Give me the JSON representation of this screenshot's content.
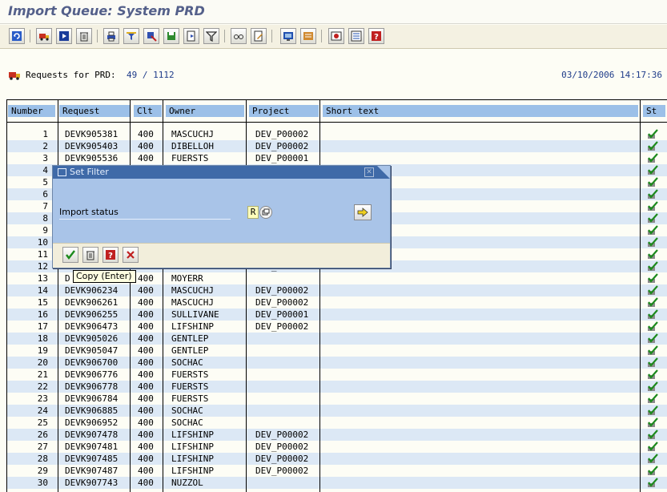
{
  "title": "Import Queue: System PRD",
  "toolbar": {
    "buttons": [
      "refresh-icon",
      "truck-icon",
      "start-icon",
      "trash-icon",
      "print-icon",
      "filter-funnel-icon",
      "select-icon",
      "save-icon",
      "export-icon",
      "filter-icon",
      "glasses-icon",
      "edit-doc-icon",
      "monitor-icon",
      "history-icon",
      "settings-icon",
      "list-icon",
      "help-icon"
    ]
  },
  "request_line": {
    "label": "Requests for PRD:",
    "count": "49 / 1112",
    "timestamp": "03/10/2006 14:17:36"
  },
  "columns": [
    "Number",
    "Request",
    "Clt",
    "Owner",
    "Project",
    "Short text",
    "St"
  ],
  "rows": [
    {
      "num": "1",
      "req": "DEVK905381",
      "clt": "400",
      "owner": "MASCUCHJ",
      "proj": "DEV_P00002"
    },
    {
      "num": "2",
      "req": "DEVK905403",
      "clt": "400",
      "owner": "DIBELLOH",
      "proj": "DEV_P00002"
    },
    {
      "num": "3",
      "req": "DEVK905536",
      "clt": "400",
      "owner": "FUERSTS",
      "proj": "DEV_P00001"
    },
    {
      "num": "4",
      "req": "",
      "clt": "",
      "owner": "",
      "proj": ""
    },
    {
      "num": "5",
      "req": "",
      "clt": "",
      "owner": "",
      "proj": ""
    },
    {
      "num": "6",
      "req": "",
      "clt": "",
      "owner": "",
      "proj": ""
    },
    {
      "num": "7",
      "req": "",
      "clt": "",
      "owner": "",
      "proj": ""
    },
    {
      "num": "8",
      "req": "",
      "clt": "",
      "owner": "",
      "proj": ""
    },
    {
      "num": "9",
      "req": "",
      "clt": "",
      "owner": "",
      "proj": ""
    },
    {
      "num": "10",
      "req": "",
      "clt": "",
      "owner": "",
      "proj": ""
    },
    {
      "num": "11",
      "req": "",
      "clt": "",
      "owner": "",
      "proj": ""
    },
    {
      "num": "12",
      "req": "",
      "clt": "",
      "owner": "",
      "proj": ""
    },
    {
      "num": "13",
      "req": "",
      "clt": "400",
      "owner": "MOYERR",
      "proj": ""
    },
    {
      "num": "14",
      "req": "DEVK906234",
      "clt": "400",
      "owner": "MASCUCHJ",
      "proj": "DEV_P00002"
    },
    {
      "num": "15",
      "req": "DEVK906261",
      "clt": "400",
      "owner": "MASCUCHJ",
      "proj": "DEV_P00002"
    },
    {
      "num": "16",
      "req": "DEVK906255",
      "clt": "400",
      "owner": "SULLIVANE",
      "proj": "DEV_P00001"
    },
    {
      "num": "17",
      "req": "DEVK906473",
      "clt": "400",
      "owner": "LIFSHINP",
      "proj": "DEV_P00002"
    },
    {
      "num": "18",
      "req": "DEVK905026",
      "clt": "400",
      "owner": "GENTLEP",
      "proj": ""
    },
    {
      "num": "19",
      "req": "DEVK905047",
      "clt": "400",
      "owner": "GENTLEP",
      "proj": ""
    },
    {
      "num": "20",
      "req": "DEVK906700",
      "clt": "400",
      "owner": "SOCHAC",
      "proj": ""
    },
    {
      "num": "21",
      "req": "DEVK906776",
      "clt": "400",
      "owner": "FUERSTS",
      "proj": ""
    },
    {
      "num": "22",
      "req": "DEVK906778",
      "clt": "400",
      "owner": "FUERSTS",
      "proj": ""
    },
    {
      "num": "23",
      "req": "DEVK906784",
      "clt": "400",
      "owner": "FUERSTS",
      "proj": ""
    },
    {
      "num": "24",
      "req": "DEVK906885",
      "clt": "400",
      "owner": "SOCHAC",
      "proj": ""
    },
    {
      "num": "25",
      "req": "DEVK906952",
      "clt": "400",
      "owner": "SOCHAC",
      "proj": ""
    },
    {
      "num": "26",
      "req": "DEVK907478",
      "clt": "400",
      "owner": "LIFSHINP",
      "proj": "DEV_P00002"
    },
    {
      "num": "27",
      "req": "DEVK907481",
      "clt": "400",
      "owner": "LIFSHINP",
      "proj": "DEV_P00002"
    },
    {
      "num": "28",
      "req": "DEVK907485",
      "clt": "400",
      "owner": "LIFSHINP",
      "proj": "DEV_P00002"
    },
    {
      "num": "29",
      "req": "DEVK907487",
      "clt": "400",
      "owner": "LIFSHINP",
      "proj": "DEV_P00002"
    },
    {
      "num": "30",
      "req": "DEVK907743",
      "clt": "400",
      "owner": "NUZZOL",
      "proj": ""
    }
  ],
  "row13_partial_req": "D",
  "row12_partial_proj": "DEV_P00001",
  "dialog": {
    "title": "Set Filter",
    "field_label": "Import status",
    "field_value": "R",
    "buttons": [
      "check-icon",
      "trash-icon",
      "help-icon",
      "cancel-icon"
    ]
  },
  "tooltip": "Copy  (Enter)",
  "colors": {
    "title": "#54608a",
    "header_bg": "#9cc0e8",
    "alt_row": "#dce8f5",
    "dialog_bg": "#a9c4e8",
    "dialog_title": "#3f6aa8",
    "link_blue": "#1f3c8a"
  }
}
